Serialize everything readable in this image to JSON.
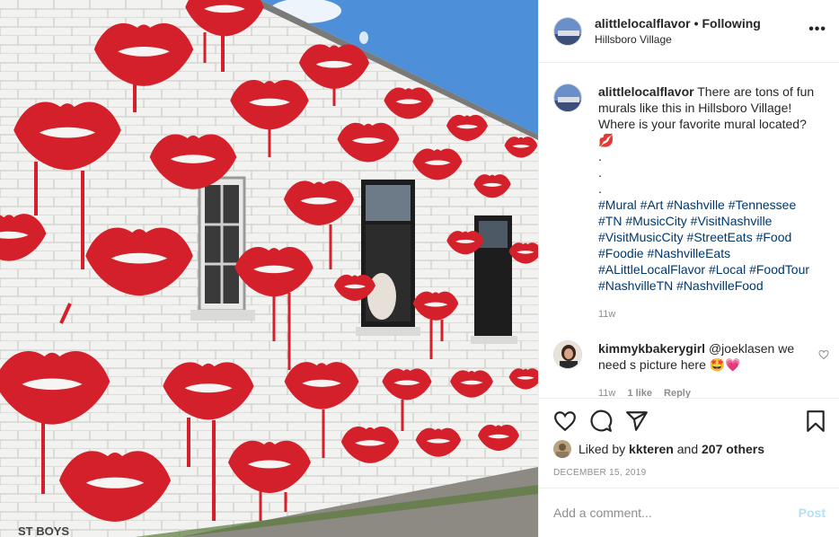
{
  "post": {
    "photo": {
      "description_icon": "photo-icon",
      "wall_text": "ST BOYS"
    },
    "header": {
      "username": "alittlelocalflavor",
      "separator": "•",
      "follow_state": "Following",
      "location": "Hillsboro Village",
      "more_icon": "more-options-icon",
      "more_label": "•••"
    },
    "caption": {
      "username": "alittlelocalflavor",
      "text": "There are tons of fun murals like this in Hillsboro Village! Where is your favorite mural located? 💋",
      "dots": [
        ".",
        ".",
        "."
      ],
      "hashtags": "#Mural #Art #Nashville #Tennessee #TN #MusicCity #VisitNashville #VisitMusicCity #StreetEats #Food #Foodie #NashvilleEats #ALittleLocalFlavor #Local #FoodTour #NashvilleTN #NashvilleFood",
      "timestamp": "11w"
    },
    "comment": {
      "username": "kimmykbakerygirl",
      "text": "@joeklasen we need s picture here 🤩💗",
      "time": "11w",
      "likes": "1 like",
      "reply": "Reply",
      "heart_icon": "heart-outline-icon"
    },
    "actions": {
      "like_icon": "heart-icon",
      "comment_icon": "comment-icon",
      "share_icon": "paper-plane-icon",
      "save_icon": "bookmark-icon"
    },
    "likes": {
      "prefix": "Liked by",
      "user": "kkteren",
      "and": "and",
      "others": "207 others"
    },
    "date": "DECEMBER 15, 2019",
    "add_comment": {
      "placeholder": "Add a comment...",
      "post_label": "Post"
    }
  },
  "colors": {
    "lips": "#d4202a",
    "brick": "#f2f2f0",
    "sky": "#4e8fd9",
    "link": "#00376b",
    "post_disabled": "#b2dffc"
  }
}
